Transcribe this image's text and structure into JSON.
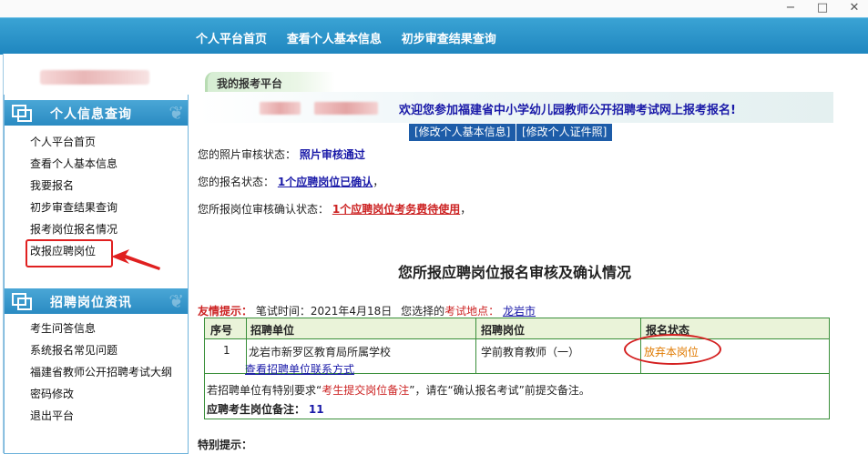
{
  "window": {
    "minimize": "−",
    "restore": "□",
    "close": "✕"
  },
  "topnav": [
    "个人平台首页",
    "查看个人基本信息",
    "初步审查结果查询"
  ],
  "sidebar": {
    "section1_title": "个人信息查询",
    "section1_items": [
      "个人平台首页",
      "查看个人基本信息",
      "我要报名",
      "初步审查结果查询",
      "报考岗位报名情况",
      "改报应聘岗位"
    ],
    "section2_title": "招聘岗位资讯",
    "section2_items": [
      "考生问答信息",
      "系统报名常见问题",
      "福建省教师公开招聘考试大纲",
      "密码修改",
      "退出平台"
    ]
  },
  "main": {
    "tab_label": "我的报考平台",
    "welcome": "欢迎您参加福建省中小学幼儿园教师公开招聘考试网上报考报名!",
    "buttons": {
      "modify_info": "[修改个人基本信息]",
      "modify_photo": "[修改个人证件照]"
    },
    "photo_status_label": "您的照片审核状态：",
    "photo_status_value": "照片审核通过",
    "apply_status_label": "您的报名状态：",
    "apply_status_value": "1个应聘岗位已确认",
    "apply_status_suffix": "，",
    "position_status_label": "您所报岗位审核确认状态：",
    "position_status_value": "1个应聘岗位考务费待使用",
    "position_status_suffix": "，",
    "heading": "您所报应聘岗位报名审核及确认情况",
    "tip_label": "友情提示：",
    "tip_exam_time": "笔试时间：2021年4月18日",
    "tip_location_pre": "您选择的",
    "tip_location_label": "考试地点：",
    "tip_location_value": "龙岩市",
    "table": {
      "headers": [
        "序号",
        "招聘单位",
        "招聘岗位",
        "报名状态"
      ],
      "row": {
        "index": "1",
        "unit": "龙岩市新罗区教育局所属学校",
        "unit_link": "查看招聘单位联系方式",
        "position": "学前教育教师（一）",
        "status": "放弃本岗位"
      },
      "note_pre": "若招聘单位有特别要求“",
      "note_red": "考生提交岗位备注",
      "note_post": "”，请在“确认报名考试”前提交备注。",
      "remark_label": "应聘考生岗位备注：",
      "remark_value": "11"
    },
    "special_tip": "特别提示："
  },
  "colors": {
    "nav_blue": "#2a8bc2",
    "highlight_red": "#e02020",
    "status_orange": "#e07a00"
  }
}
